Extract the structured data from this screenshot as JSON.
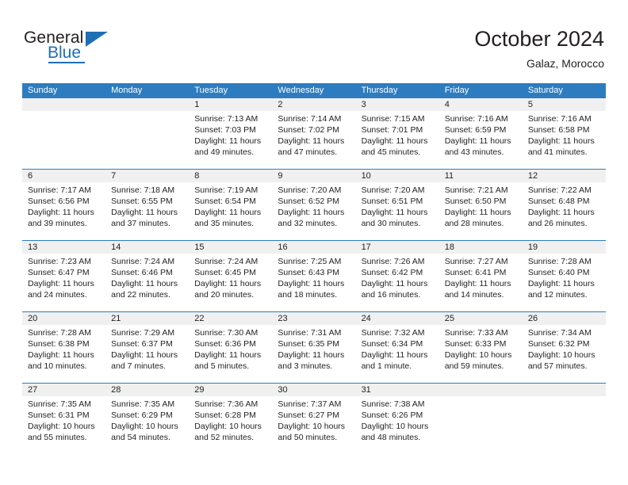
{
  "brand": {
    "name_part1": "General",
    "name_part2": "Blue",
    "accent_color": "#1f6fb5"
  },
  "header": {
    "title": "October 2024",
    "subtitle": "Galaz, Morocco"
  },
  "calendar": {
    "header_bg": "#2d7cc0",
    "number_band_bg": "#f0f0f0",
    "weekday_names": [
      "Sunday",
      "Monday",
      "Tuesday",
      "Wednesday",
      "Thursday",
      "Friday",
      "Saturday"
    ],
    "weeks": [
      [
        {
          "day": "",
          "lines": []
        },
        {
          "day": "",
          "lines": []
        },
        {
          "day": "1",
          "lines": [
            "Sunrise: 7:13 AM",
            "Sunset: 7:03 PM",
            "Daylight: 11 hours",
            "and 49 minutes."
          ]
        },
        {
          "day": "2",
          "lines": [
            "Sunrise: 7:14 AM",
            "Sunset: 7:02 PM",
            "Daylight: 11 hours",
            "and 47 minutes."
          ]
        },
        {
          "day": "3",
          "lines": [
            "Sunrise: 7:15 AM",
            "Sunset: 7:01 PM",
            "Daylight: 11 hours",
            "and 45 minutes."
          ]
        },
        {
          "day": "4",
          "lines": [
            "Sunrise: 7:16 AM",
            "Sunset: 6:59 PM",
            "Daylight: 11 hours",
            "and 43 minutes."
          ]
        },
        {
          "day": "5",
          "lines": [
            "Sunrise: 7:16 AM",
            "Sunset: 6:58 PM",
            "Daylight: 11 hours",
            "and 41 minutes."
          ]
        }
      ],
      [
        {
          "day": "6",
          "lines": [
            "Sunrise: 7:17 AM",
            "Sunset: 6:56 PM",
            "Daylight: 11 hours",
            "and 39 minutes."
          ]
        },
        {
          "day": "7",
          "lines": [
            "Sunrise: 7:18 AM",
            "Sunset: 6:55 PM",
            "Daylight: 11 hours",
            "and 37 minutes."
          ]
        },
        {
          "day": "8",
          "lines": [
            "Sunrise: 7:19 AM",
            "Sunset: 6:54 PM",
            "Daylight: 11 hours",
            "and 35 minutes."
          ]
        },
        {
          "day": "9",
          "lines": [
            "Sunrise: 7:20 AM",
            "Sunset: 6:52 PM",
            "Daylight: 11 hours",
            "and 32 minutes."
          ]
        },
        {
          "day": "10",
          "lines": [
            "Sunrise: 7:20 AM",
            "Sunset: 6:51 PM",
            "Daylight: 11 hours",
            "and 30 minutes."
          ]
        },
        {
          "day": "11",
          "lines": [
            "Sunrise: 7:21 AM",
            "Sunset: 6:50 PM",
            "Daylight: 11 hours",
            "and 28 minutes."
          ]
        },
        {
          "day": "12",
          "lines": [
            "Sunrise: 7:22 AM",
            "Sunset: 6:48 PM",
            "Daylight: 11 hours",
            "and 26 minutes."
          ]
        }
      ],
      [
        {
          "day": "13",
          "lines": [
            "Sunrise: 7:23 AM",
            "Sunset: 6:47 PM",
            "Daylight: 11 hours",
            "and 24 minutes."
          ]
        },
        {
          "day": "14",
          "lines": [
            "Sunrise: 7:24 AM",
            "Sunset: 6:46 PM",
            "Daylight: 11 hours",
            "and 22 minutes."
          ]
        },
        {
          "day": "15",
          "lines": [
            "Sunrise: 7:24 AM",
            "Sunset: 6:45 PM",
            "Daylight: 11 hours",
            "and 20 minutes."
          ]
        },
        {
          "day": "16",
          "lines": [
            "Sunrise: 7:25 AM",
            "Sunset: 6:43 PM",
            "Daylight: 11 hours",
            "and 18 minutes."
          ]
        },
        {
          "day": "17",
          "lines": [
            "Sunrise: 7:26 AM",
            "Sunset: 6:42 PM",
            "Daylight: 11 hours",
            "and 16 minutes."
          ]
        },
        {
          "day": "18",
          "lines": [
            "Sunrise: 7:27 AM",
            "Sunset: 6:41 PM",
            "Daylight: 11 hours",
            "and 14 minutes."
          ]
        },
        {
          "day": "19",
          "lines": [
            "Sunrise: 7:28 AM",
            "Sunset: 6:40 PM",
            "Daylight: 11 hours",
            "and 12 minutes."
          ]
        }
      ],
      [
        {
          "day": "20",
          "lines": [
            "Sunrise: 7:28 AM",
            "Sunset: 6:38 PM",
            "Daylight: 11 hours",
            "and 10 minutes."
          ]
        },
        {
          "day": "21",
          "lines": [
            "Sunrise: 7:29 AM",
            "Sunset: 6:37 PM",
            "Daylight: 11 hours",
            "and 7 minutes."
          ]
        },
        {
          "day": "22",
          "lines": [
            "Sunrise: 7:30 AM",
            "Sunset: 6:36 PM",
            "Daylight: 11 hours",
            "and 5 minutes."
          ]
        },
        {
          "day": "23",
          "lines": [
            "Sunrise: 7:31 AM",
            "Sunset: 6:35 PM",
            "Daylight: 11 hours",
            "and 3 minutes."
          ]
        },
        {
          "day": "24",
          "lines": [
            "Sunrise: 7:32 AM",
            "Sunset: 6:34 PM",
            "Daylight: 11 hours",
            "and 1 minute."
          ]
        },
        {
          "day": "25",
          "lines": [
            "Sunrise: 7:33 AM",
            "Sunset: 6:33 PM",
            "Daylight: 10 hours",
            "and 59 minutes."
          ]
        },
        {
          "day": "26",
          "lines": [
            "Sunrise: 7:34 AM",
            "Sunset: 6:32 PM",
            "Daylight: 10 hours",
            "and 57 minutes."
          ]
        }
      ],
      [
        {
          "day": "27",
          "lines": [
            "Sunrise: 7:35 AM",
            "Sunset: 6:31 PM",
            "Daylight: 10 hours",
            "and 55 minutes."
          ]
        },
        {
          "day": "28",
          "lines": [
            "Sunrise: 7:35 AM",
            "Sunset: 6:29 PM",
            "Daylight: 10 hours",
            "and 54 minutes."
          ]
        },
        {
          "day": "29",
          "lines": [
            "Sunrise: 7:36 AM",
            "Sunset: 6:28 PM",
            "Daylight: 10 hours",
            "and 52 minutes."
          ]
        },
        {
          "day": "30",
          "lines": [
            "Sunrise: 7:37 AM",
            "Sunset: 6:27 PM",
            "Daylight: 10 hours",
            "and 50 minutes."
          ]
        },
        {
          "day": "31",
          "lines": [
            "Sunrise: 7:38 AM",
            "Sunset: 6:26 PM",
            "Daylight: 10 hours",
            "and 48 minutes."
          ]
        },
        {
          "day": "",
          "lines": []
        },
        {
          "day": "",
          "lines": []
        }
      ]
    ]
  }
}
